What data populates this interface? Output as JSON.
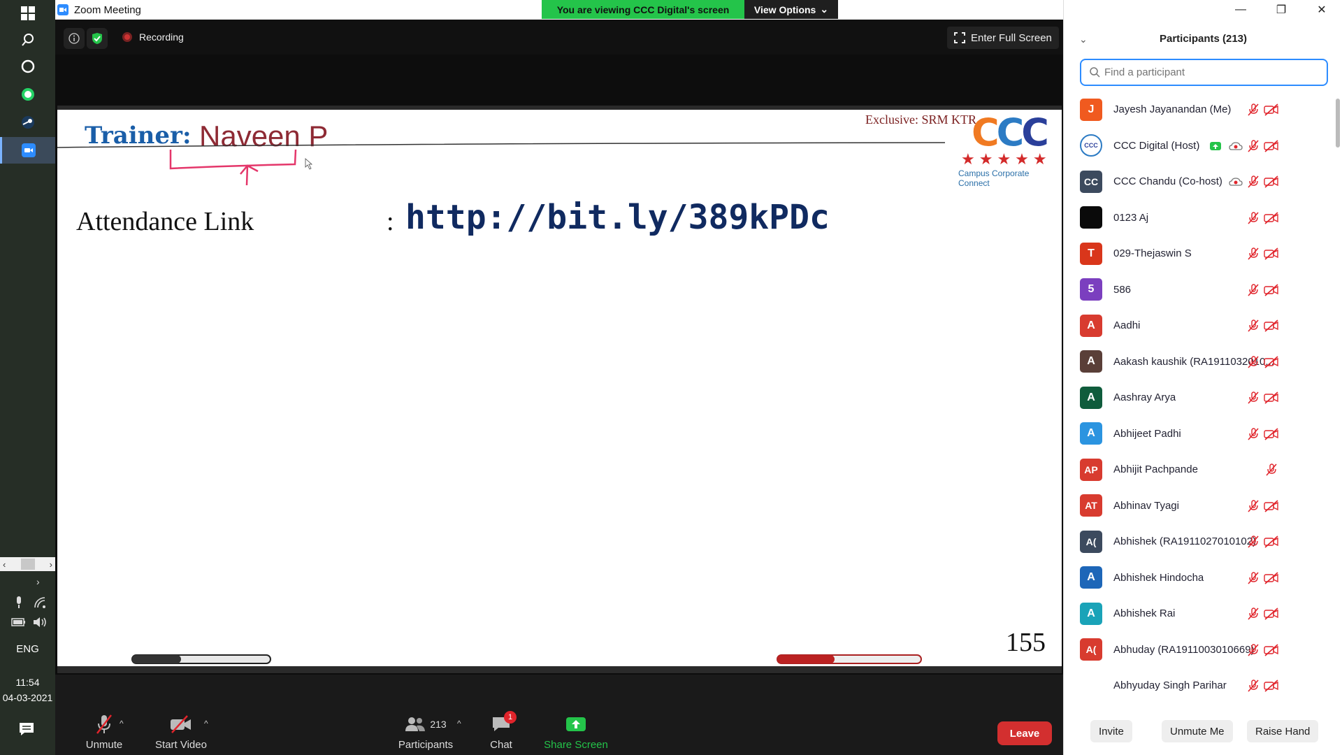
{
  "window": {
    "title": "Zoom Meeting",
    "minimize_icon": "—",
    "maximize_icon": "❐",
    "close_icon": "✕"
  },
  "banner": {
    "viewing": "You are viewing CCC Digital's screen",
    "view_options": "View Options"
  },
  "meeting_info": {
    "recording_label": "Recording",
    "fullscreen_label": "Enter Full Screen"
  },
  "slide": {
    "trainer_label": "Trainer:",
    "trainer_name": "Naveen P",
    "exclusive": "Exclusive: SRM KTR",
    "logo_text": "CCC",
    "logo_stars": "★★★★★",
    "logo_tagline": "Campus Corporate Connect",
    "attendance_label": "Attendance Link",
    "attendance_colon": ":",
    "attendance_link": "http://bit.ly/389kPDc",
    "page_number": "155"
  },
  "toolbar": {
    "unmute": "Unmute",
    "start_video": "Start Video",
    "participants": "Participants",
    "participants_count": "213",
    "chat": "Chat",
    "chat_badge": "1",
    "share_screen": "Share Screen",
    "leave": "Leave"
  },
  "panel": {
    "title": "Participants (213)",
    "search_placeholder": "Find a participant",
    "participants": [
      {
        "name": "Jayesh Jayanandan (Me)",
        "initials": "J",
        "color": "#f05a1f"
      },
      {
        "name": "CCC Digital (Host)",
        "initials": "CCC",
        "color": "#ffffff"
      },
      {
        "name": "CCC Chandu (Co-host)",
        "initials": "CC",
        "color": "#3c4a5e"
      },
      {
        "name": "0123 Aj",
        "initials": "",
        "color": "#0a0a0a"
      },
      {
        "name": "029-Thejaswin S",
        "initials": "T",
        "color": "#d9361b"
      },
      {
        "name": "586",
        "initials": "5",
        "color": "#7b3fbf"
      },
      {
        "name": "Aadhi",
        "initials": "A",
        "color": "#d83b2f"
      },
      {
        "name": "Aakash kaushik (RA1911032010...",
        "initials": "A",
        "color": "#5a3f38"
      },
      {
        "name": "Aashray Arya",
        "initials": "A",
        "color": "#0f5c3c"
      },
      {
        "name": "Abhijeet Padhi",
        "initials": "A",
        "color": "#2b94e0"
      },
      {
        "name": "Abhijit Pachpande",
        "initials": "AP",
        "color": "#d83b2f"
      },
      {
        "name": "Abhinav Tyagi",
        "initials": "AT",
        "color": "#d83b2f"
      },
      {
        "name": "Abhishek (RA1911027010102)",
        "initials": "A(",
        "color": "#3c4a5e"
      },
      {
        "name": "Abhishek Hindocha",
        "initials": "A",
        "color": "#1d66b8"
      },
      {
        "name": "Abhishek Rai",
        "initials": "A",
        "color": "#1aa3b8"
      },
      {
        "name": "Abhuday (RA1911003010669)",
        "initials": "A(",
        "color": "#d83b2f"
      },
      {
        "name": "Abhyuday Singh Parihar",
        "initials": "",
        "color": "#ffffff"
      }
    ],
    "invite": "Invite",
    "unmute_me": "Unmute Me",
    "raise_hand": "Raise Hand"
  },
  "taskbar": {
    "language": "ENG",
    "time": "11:54",
    "date": "04-03-2021"
  },
  "icons": [
    "windows-icon",
    "search-icon",
    "cortana-icon",
    "whatsapp-icon",
    "steam-icon",
    "zoom-icon",
    "mic-muted-icon",
    "video-off-icon",
    "participants-icon",
    "chat-icon",
    "share-screen-icon",
    "info-icon",
    "shield-icon",
    "fullscreen-icon"
  ]
}
